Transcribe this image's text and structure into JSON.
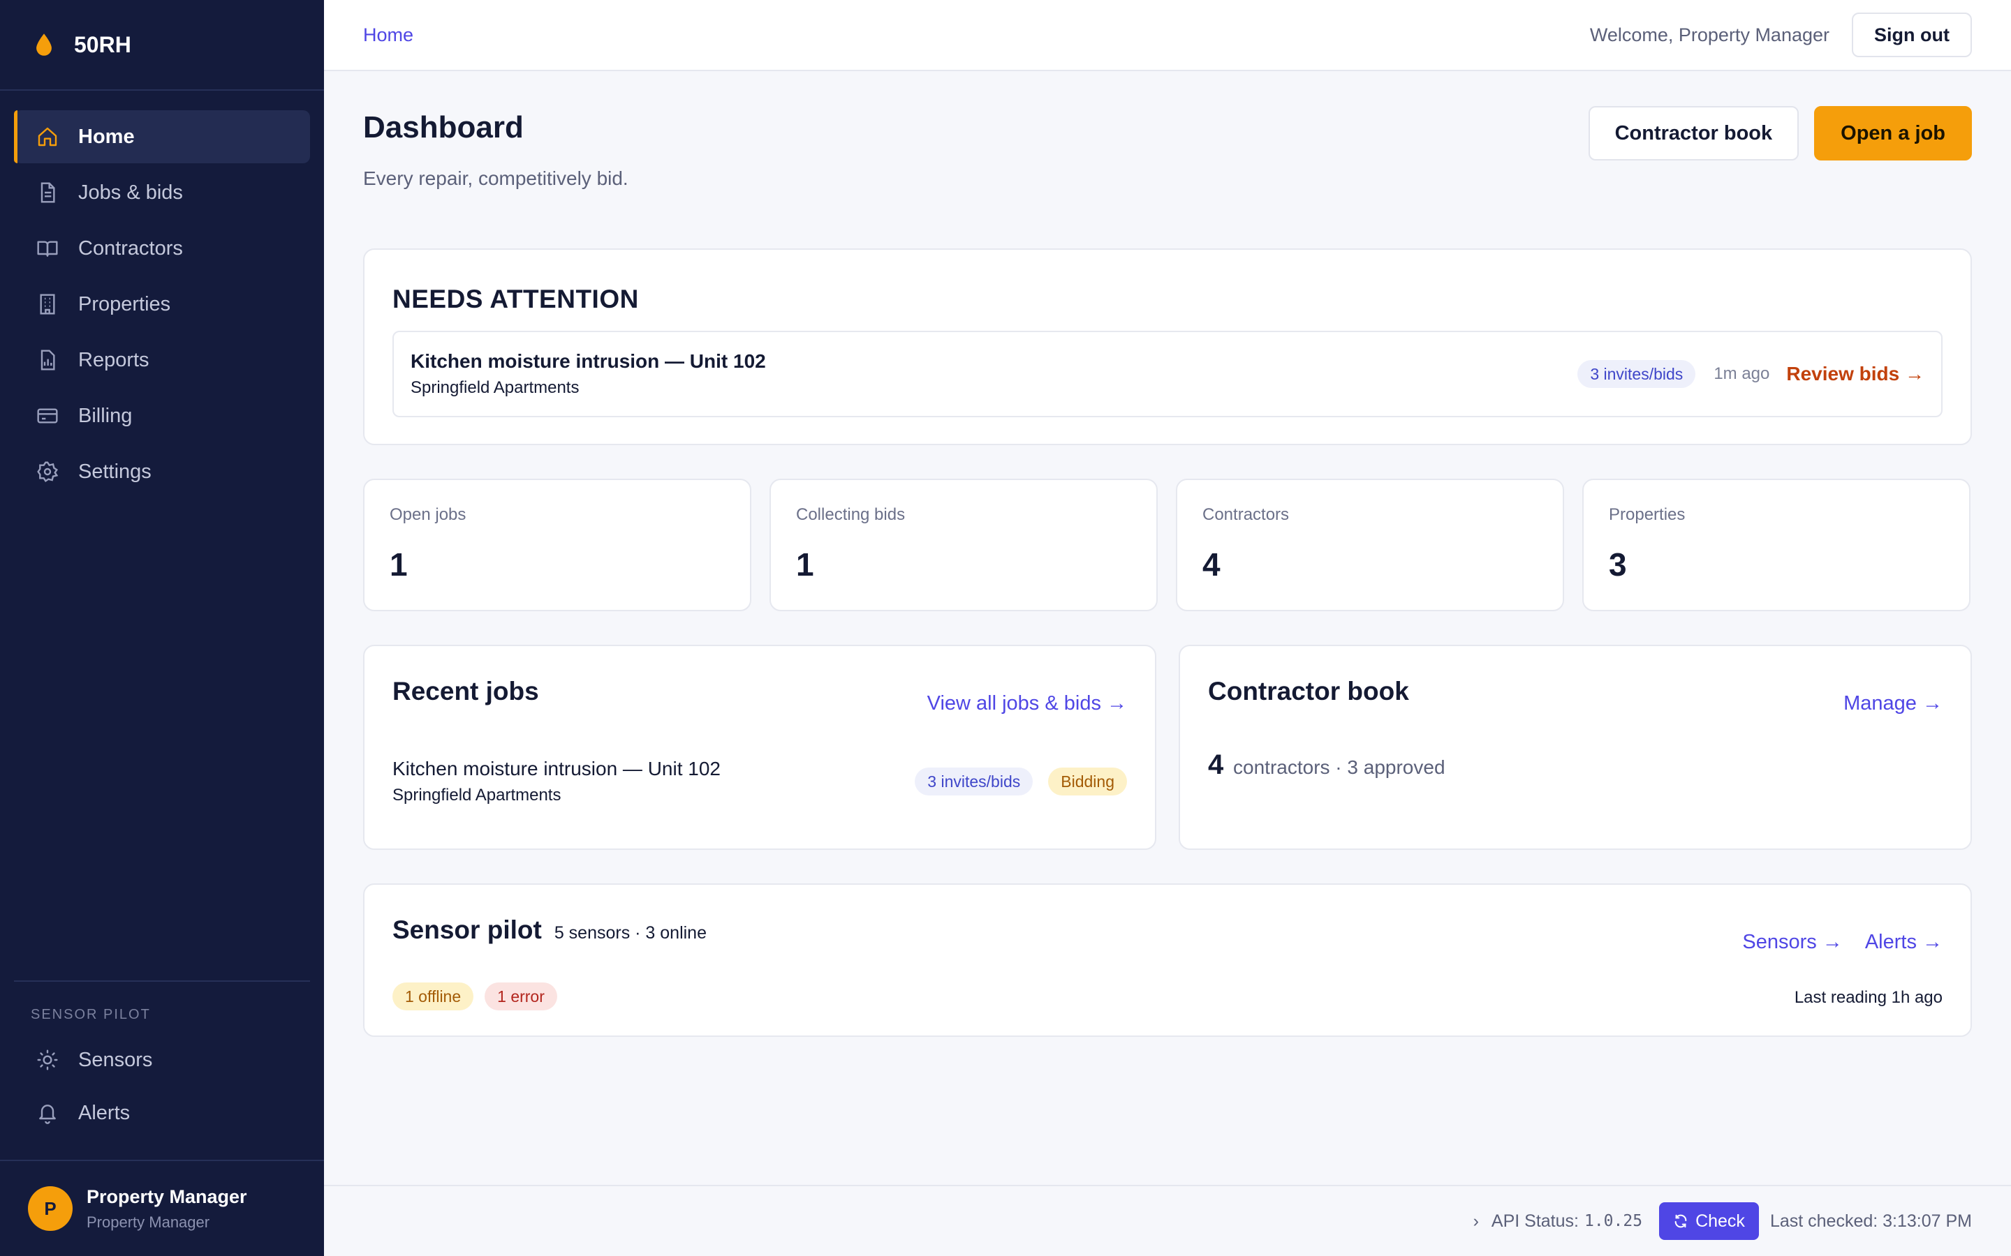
{
  "app": {
    "name": "50RH",
    "accent": "#f59e0b",
    "sidebar_bg": "#141b3c",
    "link_color": "#4f46e5"
  },
  "sidebar": {
    "items": [
      {
        "label": "Home",
        "icon": "home-icon",
        "active": true
      },
      {
        "label": "Jobs & bids",
        "icon": "document-icon"
      },
      {
        "label": "Contractors",
        "icon": "book-icon"
      },
      {
        "label": "Properties",
        "icon": "building-icon"
      },
      {
        "label": "Reports",
        "icon": "report-icon"
      },
      {
        "label": "Billing",
        "icon": "credit-card-icon"
      },
      {
        "label": "Settings",
        "icon": "gear-icon"
      }
    ],
    "section_label": "SENSOR PILOT",
    "section_items": [
      {
        "label": "Sensors",
        "icon": "sun-icon"
      },
      {
        "label": "Alerts",
        "icon": "bell-icon"
      }
    ],
    "user": {
      "initial": "P",
      "name": "Property Manager",
      "role": "Property Manager"
    }
  },
  "topbar": {
    "breadcrumb": "Home",
    "welcome": "Welcome, Property Manager",
    "signout": "Sign out"
  },
  "header": {
    "title": "Dashboard",
    "subtitle": "Every repair, competitively bid.",
    "contractor_book_btn": "Contractor book",
    "open_job_btn": "Open a job"
  },
  "attention": {
    "title": "NEEDS ATTENTION",
    "item": {
      "title": "Kitchen moisture intrusion — Unit 102",
      "property": "Springfield Apartments",
      "badge": "3 invites/bids",
      "ago": "1m ago",
      "action": "Review bids →"
    }
  },
  "stats": [
    {
      "label": "Open jobs",
      "value": "1"
    },
    {
      "label": "Collecting bids",
      "value": "1"
    },
    {
      "label": "Contractors",
      "value": "4"
    },
    {
      "label": "Properties",
      "value": "3"
    }
  ],
  "recent_jobs": {
    "title": "Recent jobs",
    "link": "View all jobs & bids →",
    "rows": [
      {
        "title": "Kitchen moisture intrusion — Unit 102",
        "property": "Springfield Apartments",
        "badge": "3 invites/bids",
        "status": "Bidding"
      }
    ]
  },
  "contractor_book": {
    "title": "Contractor book",
    "link": "Manage →",
    "count": "4",
    "summary": "contractors · 3 approved"
  },
  "sensor_pilot": {
    "title": "Sensor pilot",
    "meta": "5 sensors · 3 online",
    "link_sensors": "Sensors →",
    "link_alerts": "Alerts →",
    "pill_offline": "1 offline",
    "pill_error": "1 error",
    "last_reading": "Last reading 1h ago"
  },
  "footer": {
    "api_label": "API Status:",
    "version": "1.0.25",
    "check": "Check",
    "last_checked": "Last checked: 3:13:07 PM"
  }
}
